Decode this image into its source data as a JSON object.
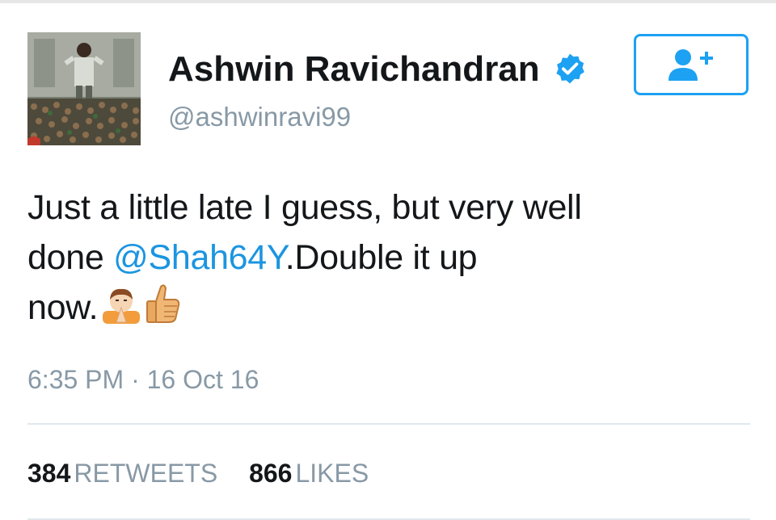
{
  "user": {
    "display_name": "Ashwin Ravichandran",
    "handle": "@ashwinravi99",
    "verified": true,
    "avatar": "profile-photo"
  },
  "follow_button": {
    "icon": "add-user-icon"
  },
  "tweet": {
    "line1": "Just a little late I guess, but very well",
    "line2_prefix": "done ",
    "mention": "@Shah64Y",
    "line2_suffix": ".Double it up",
    "line3": "now.",
    "emojis": [
      "folded-hands-emoji",
      "thumbs-up-emoji"
    ]
  },
  "timestamp": "6:35 PM · 16 Oct 16",
  "stats": {
    "retweets_count": "384",
    "retweets_label": "RETWEETS",
    "likes_count": "866",
    "likes_label": "LIKES"
  },
  "colors": {
    "accent": "#1da1f2",
    "mention": "#1b95e0",
    "secondary_text": "#8899a6",
    "divider": "#e1e8ed"
  }
}
